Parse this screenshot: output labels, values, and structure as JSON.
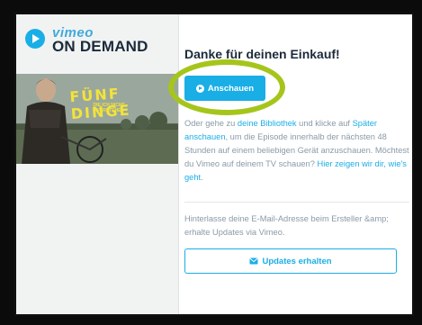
{
  "brand": {
    "vimeo": "vimeo",
    "on_demand": "ON DEMAND"
  },
  "poster": {
    "title": "FÜNF DINGE",
    "subtitle": "DIE ICH NICHT VERSTEHE"
  },
  "dialog": {
    "heading": "Danke für deinen Einkauf!",
    "watch_button": "Anschauen",
    "info": {
      "p1": "Oder gehe zu ",
      "library_link": "deine Bibliothek",
      "p2": " und klicke auf ",
      "later_link": "Später anschauen",
      "p3": ", um die Episode innerhalb der nächsten 48 Stunden auf einem beliebigen Gerät anzuschauen. Möchtest du Vimeo auf deinem TV schauen? ",
      "tv_link": "Hier zeigen wir dir, wie's geht",
      "p4": "."
    },
    "notify_text": "Hinterlasse deine E-Mail-Adresse beim Ersteller &amp; erhalte Updates via Vimeo.",
    "updates_button": "Updates erhalten"
  },
  "colors": {
    "accent": "#1aaee6",
    "highlight": "#a6c51b",
    "brand_dark": "#1b2a3a"
  }
}
